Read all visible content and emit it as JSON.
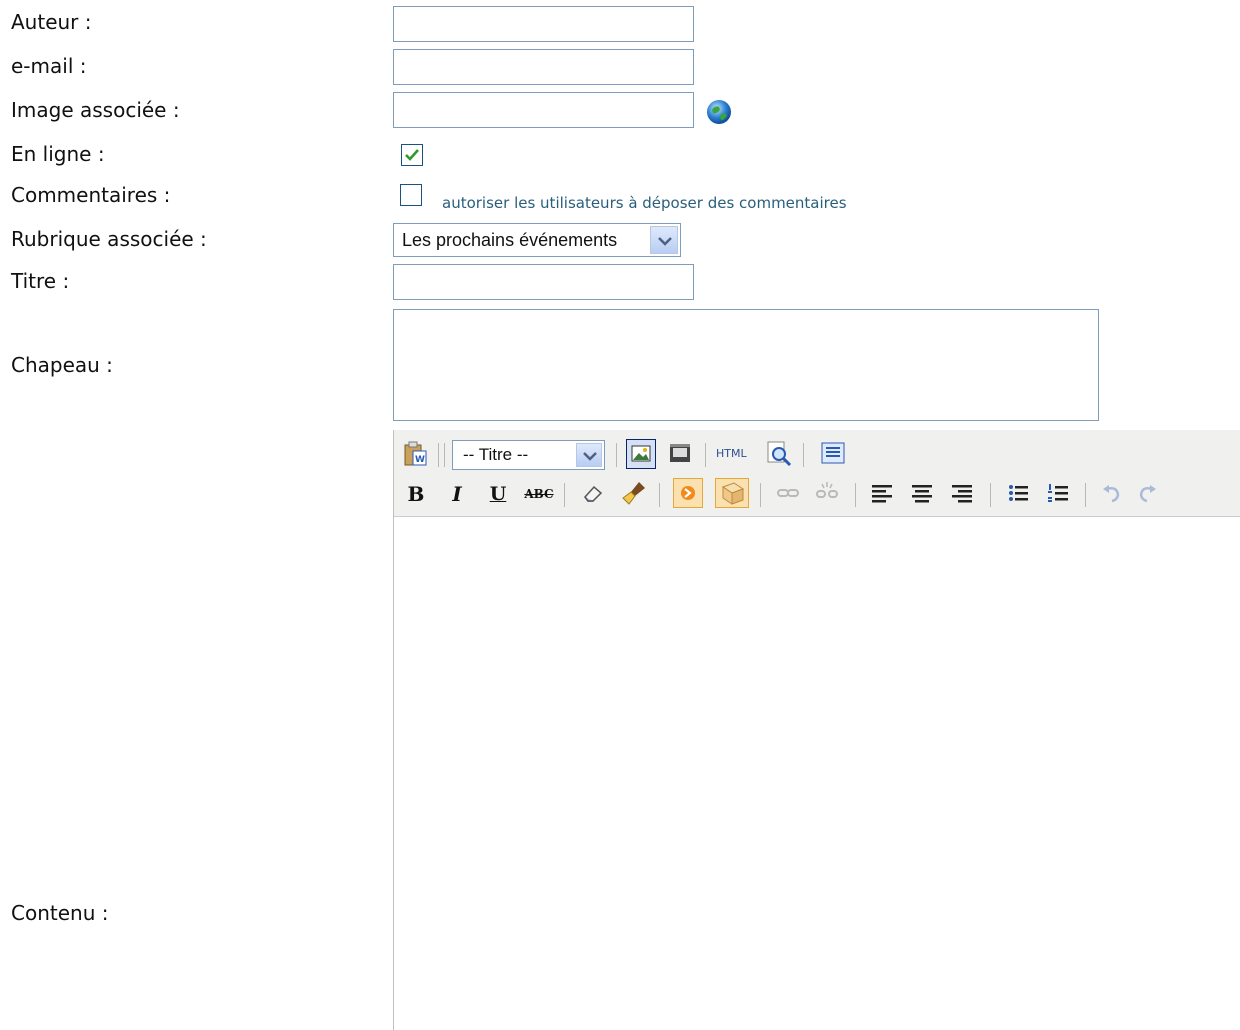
{
  "form": {
    "author_label": "Auteur :",
    "email_label": "e-mail :",
    "image_label": "Image associée :",
    "online_label": "En ligne :",
    "online_checked": true,
    "comments_label": "Commentaires :",
    "comments_checked": false,
    "comments_note": "autoriser les utilisateurs à déposer des commentaires",
    "category_label": "Rubrique associée :",
    "category_value": "Les prochains événements",
    "title_label": "Titre :",
    "lead_label": "Chapeau :",
    "content_label": "Contenu :"
  },
  "editor": {
    "format_select": "-- Titre --",
    "buttons": {
      "bold": "B",
      "italic": "I",
      "underline": "U",
      "strike": "ABC",
      "html": "HTML"
    },
    "icons": [
      "paste-word-icon",
      "image-icon",
      "media-icon",
      "html-source-icon",
      "preview-icon",
      "template-icon",
      "eraser-icon",
      "cleanup-brush-icon",
      "anchor-icon",
      "box-icon",
      "link-icon",
      "unlink-icon",
      "align-left-icon",
      "align-center-icon",
      "align-right-icon",
      "bullet-list-icon",
      "numbered-list-icon",
      "undo-icon",
      "redo-icon"
    ]
  },
  "colors": {
    "input_border": "#7f9db9",
    "toolbar_bg": "#f0f0ee",
    "note_text": "#2a5f7c",
    "check_green": "#2e9a2e"
  }
}
